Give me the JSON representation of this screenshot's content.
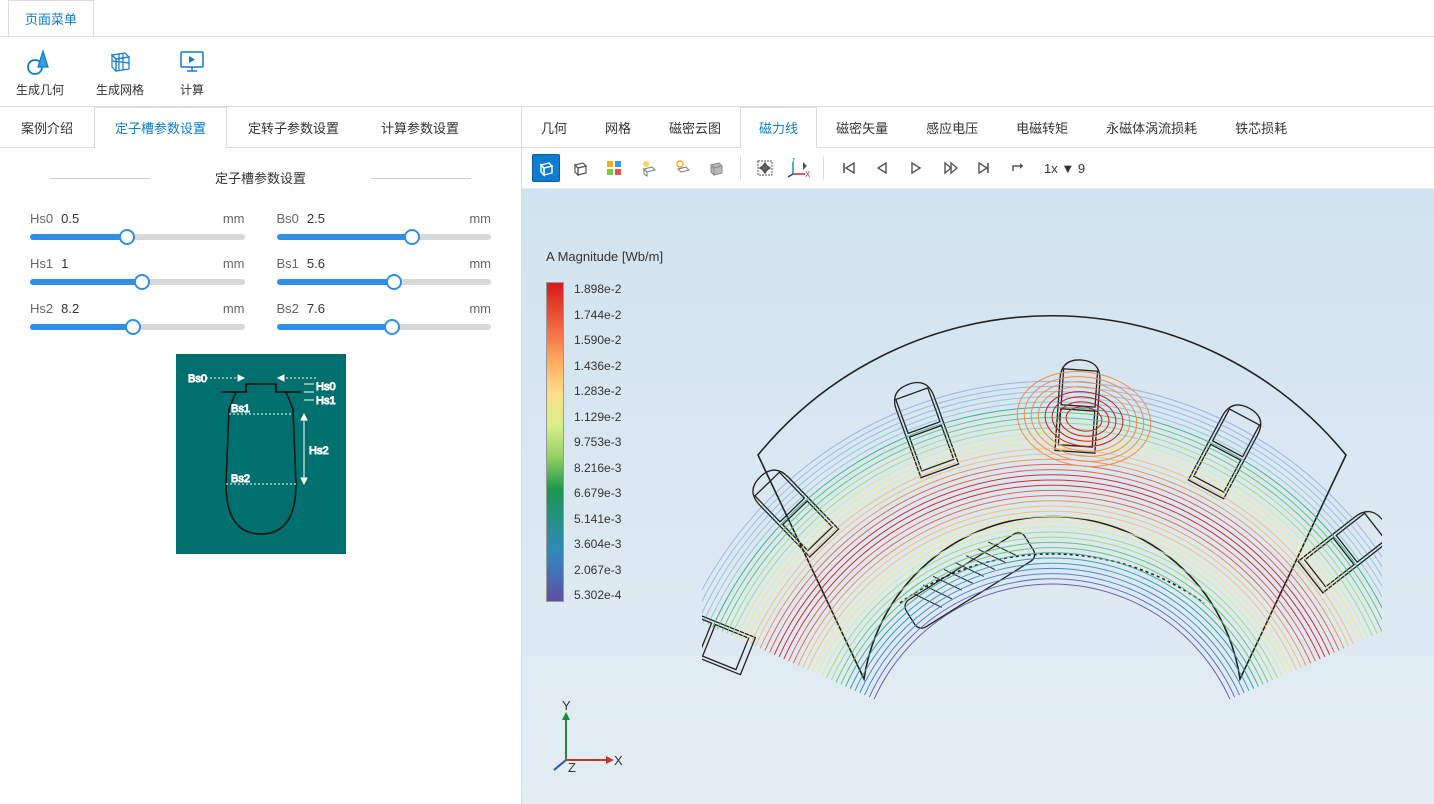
{
  "top_menu": {
    "tab1": "页面菜单"
  },
  "ribbon": {
    "geom": "生成几何",
    "mesh": "生成网格",
    "compute": "计算"
  },
  "left_tabs": [
    "案例介绍",
    "定子槽参数设置",
    "定转子参数设置",
    "计算参数设置"
  ],
  "active_left_tab": "定子槽参数设置",
  "param_title": "定子槽参数设置",
  "params": [
    {
      "label": "Hs0",
      "value": "0.5",
      "unit": "mm",
      "fill": 45
    },
    {
      "label": "Bs0",
      "value": "2.5",
      "unit": "mm",
      "fill": 63
    },
    {
      "label": "Hs1",
      "value": "1",
      "unit": "mm",
      "fill": 52
    },
    {
      "label": "Bs1",
      "value": "5.6",
      "unit": "mm",
      "fill": 55
    },
    {
      "label": "Hs2",
      "value": "8.2",
      "unit": "mm",
      "fill": 48
    },
    {
      "label": "Bs2",
      "value": "7.6",
      "unit": "mm",
      "fill": 54
    }
  ],
  "slot_diagram_labels": {
    "Bs0": "Bs0",
    "Hs0": "Hs0",
    "Hs1": "Hs1",
    "Bs1": "Bs1",
    "Hs2": "Hs2",
    "Bs2": "Bs2"
  },
  "right_tabs": [
    "几何",
    "网格",
    "磁密云图",
    "磁力线",
    "磁密矢量",
    "感应电压",
    "电磁转矩",
    "永磁体涡流损耗",
    "铁芯损耗"
  ],
  "active_right_tab": "磁力线",
  "toolbar_playback_text": "1x ▼  9",
  "legend_title": "A Magnitude [Wb/m]",
  "legend_ticks": [
    "1.898e-2",
    "1.744e-2",
    "1.590e-2",
    "1.436e-2",
    "1.283e-2",
    "1.129e-2",
    "9.753e-3",
    "8.216e-3",
    "6.679e-3",
    "5.141e-3",
    "3.604e-3",
    "2.067e-3",
    "5.302e-4"
  ],
  "axis": {
    "x": "X",
    "y": "Y",
    "z": "Z"
  },
  "chart_data": {
    "type": "contour",
    "quantity": "A Magnitude",
    "unit": "Wb/m",
    "color_levels": [
      0.0005302,
      0.002067,
      0.003604,
      0.005141,
      0.006679,
      0.008216,
      0.009753,
      0.01129,
      0.01283,
      0.01436,
      0.0159,
      0.01744,
      0.01898
    ],
    "geometry": "SPM motor sector (stator + rotor slice) with 6 stator slots and 1 PM rotor pole",
    "fields_shown": "magnetic vector potential isolines"
  }
}
